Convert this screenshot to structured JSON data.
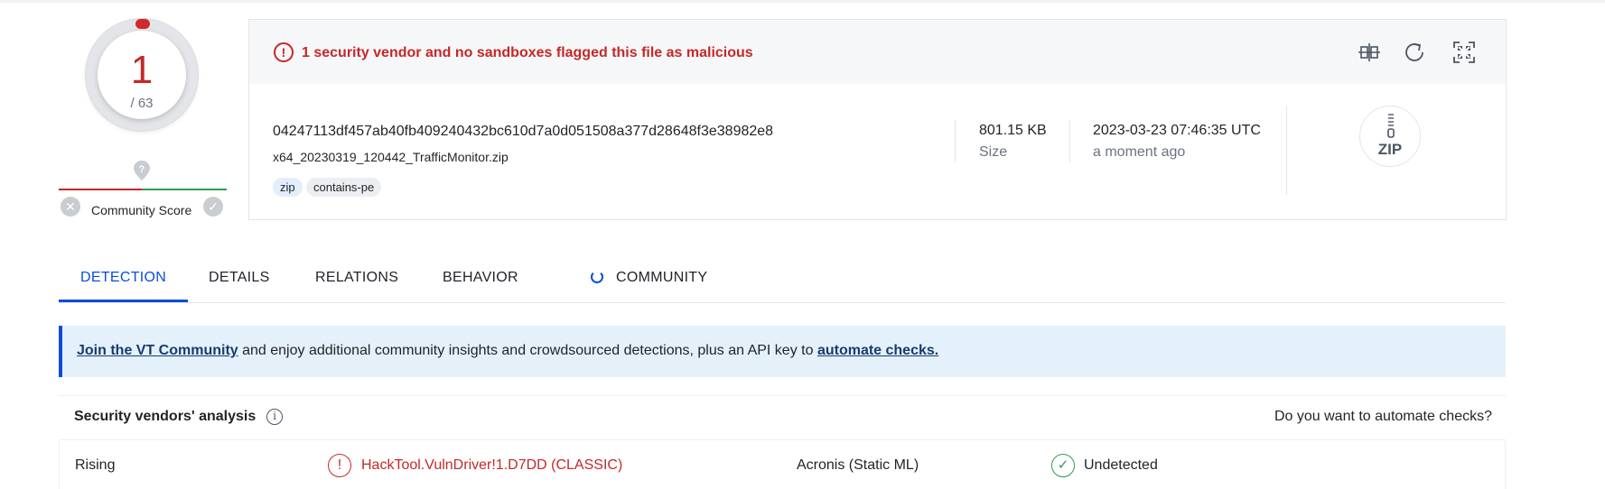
{
  "detection_score": {
    "positives": "1",
    "total": "/ 63"
  },
  "community_score": {
    "label": "Community Score",
    "pin_icon": "question-pin-icon",
    "downvote_icon": "x-icon",
    "upvote_icon": "check-icon"
  },
  "summary": {
    "alert_text": "1 security vendor and no sandboxes flagged this file as malicious",
    "alert_icon": "exclamation-circle-icon",
    "actions": [
      "compare-icon",
      "reanalyze-icon",
      "similar-icon"
    ],
    "sha256": "04247113df457ab40fb409240432bc610d7a0d051508a377d28648f3e38982e8",
    "filename": "x64_20230319_120442_TrafficMonitor.zip",
    "tags": [
      "zip",
      "contains-pe"
    ],
    "size_value": "801.15 KB",
    "size_label": "Size",
    "date_value": "2023-03-23 07:46:35 UTC",
    "date_label": "a moment ago",
    "file_type_badge": "ZIP"
  },
  "tabs": [
    {
      "label": "DETECTION",
      "active": true
    },
    {
      "label": "DETAILS",
      "active": false
    },
    {
      "label": "RELATIONS",
      "active": false
    },
    {
      "label": "BEHAVIOR",
      "active": false
    },
    {
      "label": "COMMUNITY",
      "active": false
    }
  ],
  "banner": {
    "link1": "Join the VT Community",
    "middle": " and enjoy additional community insights and crowdsourced detections, plus an API key to ",
    "link2": "automate checks."
  },
  "analysis": {
    "title": "Security vendors' analysis",
    "automate_question": "Do you want to automate checks?",
    "rows": [
      {
        "vendor1": "Rising",
        "result1": "HackTool.VulnDriver!1.D7DD (CLASSIC)",
        "vendor2": "Acronis (Static ML)",
        "result2": "Undetected"
      }
    ]
  },
  "colors": {
    "malicious": "#c62828",
    "clean": "#2e9d4c",
    "accent": "#0b4dda",
    "banner_bg": "#e4f1fb"
  }
}
